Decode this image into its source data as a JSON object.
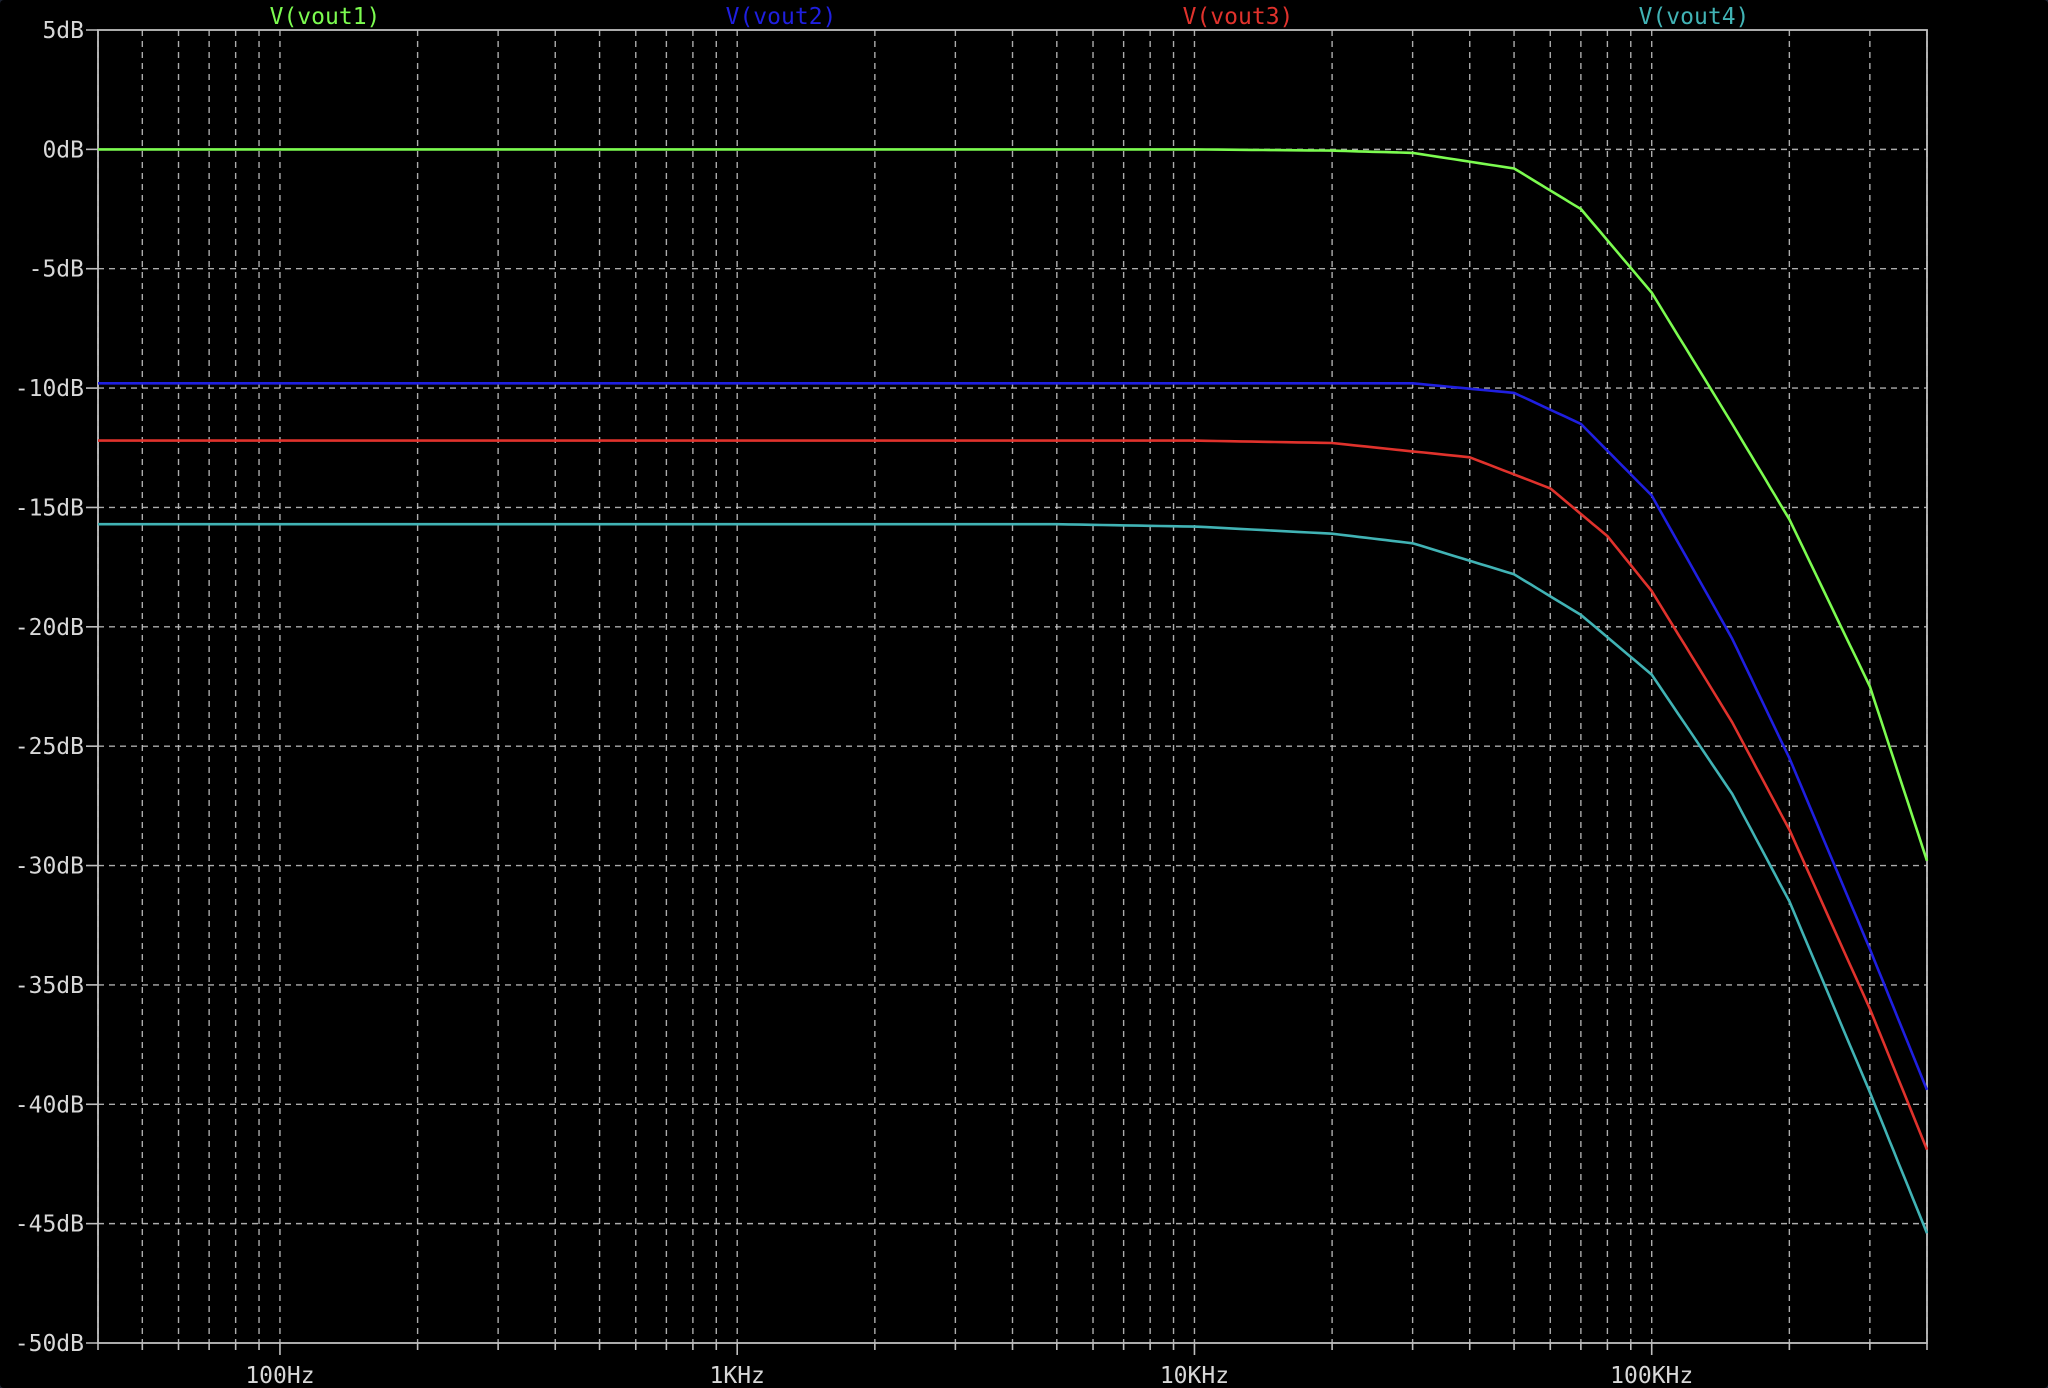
{
  "chart_data": {
    "type": "line",
    "x_scale": "log",
    "x_range_hz": [
      40,
      400000
    ],
    "ylim_db": [
      -50,
      5
    ],
    "grid": true,
    "grid_style": "dashed",
    "background_color": "#000000",
    "axis_color": "#bfbfbf",
    "grid_color": "#bfbfbf",
    "text_color": "#d8d8d8",
    "x_tick_values": [
      100,
      1000,
      10000,
      100000
    ],
    "x_tick_labels": [
      "100Hz",
      "1KHz",
      "10KHz",
      "100KHz"
    ],
    "y_tick_values": [
      5,
      0,
      -5,
      -10,
      -15,
      -20,
      -25,
      -30,
      -35,
      -40,
      -45,
      -50
    ],
    "y_tick_labels": [
      "5dB",
      "0dB",
      "-5dB",
      "-10dB",
      "-15dB",
      "-20dB",
      "-25dB",
      "-30dB",
      "-35dB",
      "-40dB",
      "-45dB",
      "-50dB"
    ],
    "series": [
      {
        "name": "V(vout1)",
        "color": "#7cfc50",
        "points": [
          [
            40,
            0
          ],
          [
            1000,
            0
          ],
          [
            10000,
            0
          ],
          [
            20000,
            -0.05
          ],
          [
            30000,
            -0.15
          ],
          [
            50000,
            -0.8
          ],
          [
            70000,
            -2.5
          ],
          [
            100000,
            -6.0
          ],
          [
            150000,
            -11.5
          ],
          [
            200000,
            -15.5
          ],
          [
            300000,
            -22.5
          ],
          [
            400000,
            -29.8
          ]
        ]
      },
      {
        "name": "V(vout2)",
        "color": "#1f1fe0",
        "points": [
          [
            40,
            -9.8
          ],
          [
            1000,
            -9.8
          ],
          [
            10000,
            -9.8
          ],
          [
            30000,
            -9.8
          ],
          [
            50000,
            -10.2
          ],
          [
            70000,
            -11.5
          ],
          [
            100000,
            -14.5
          ],
          [
            150000,
            -20.5
          ],
          [
            200000,
            -25.5
          ],
          [
            300000,
            -33.5
          ],
          [
            400000,
            -39.4
          ]
        ]
      },
      {
        "name": "V(vout3)",
        "color": "#e0322c",
        "points": [
          [
            40,
            -12.2
          ],
          [
            1000,
            -12.2
          ],
          [
            10000,
            -12.2
          ],
          [
            20000,
            -12.3
          ],
          [
            40000,
            -12.9
          ],
          [
            60000,
            -14.2
          ],
          [
            80000,
            -16.2
          ],
          [
            100000,
            -18.5
          ],
          [
            150000,
            -24.0
          ],
          [
            200000,
            -28.5
          ],
          [
            300000,
            -36.0
          ],
          [
            400000,
            -41.9
          ]
        ]
      },
      {
        "name": "V(vout4)",
        "color": "#41b3b5",
        "points": [
          [
            40,
            -15.7
          ],
          [
            1000,
            -15.7
          ],
          [
            5000,
            -15.7
          ],
          [
            10000,
            -15.8
          ],
          [
            20000,
            -16.1
          ],
          [
            30000,
            -16.5
          ],
          [
            50000,
            -17.8
          ],
          [
            70000,
            -19.5
          ],
          [
            100000,
            -22.0
          ],
          [
            150000,
            -27.0
          ],
          [
            200000,
            -31.5
          ],
          [
            300000,
            -39.5
          ],
          [
            400000,
            -45.4
          ]
        ]
      }
    ]
  }
}
